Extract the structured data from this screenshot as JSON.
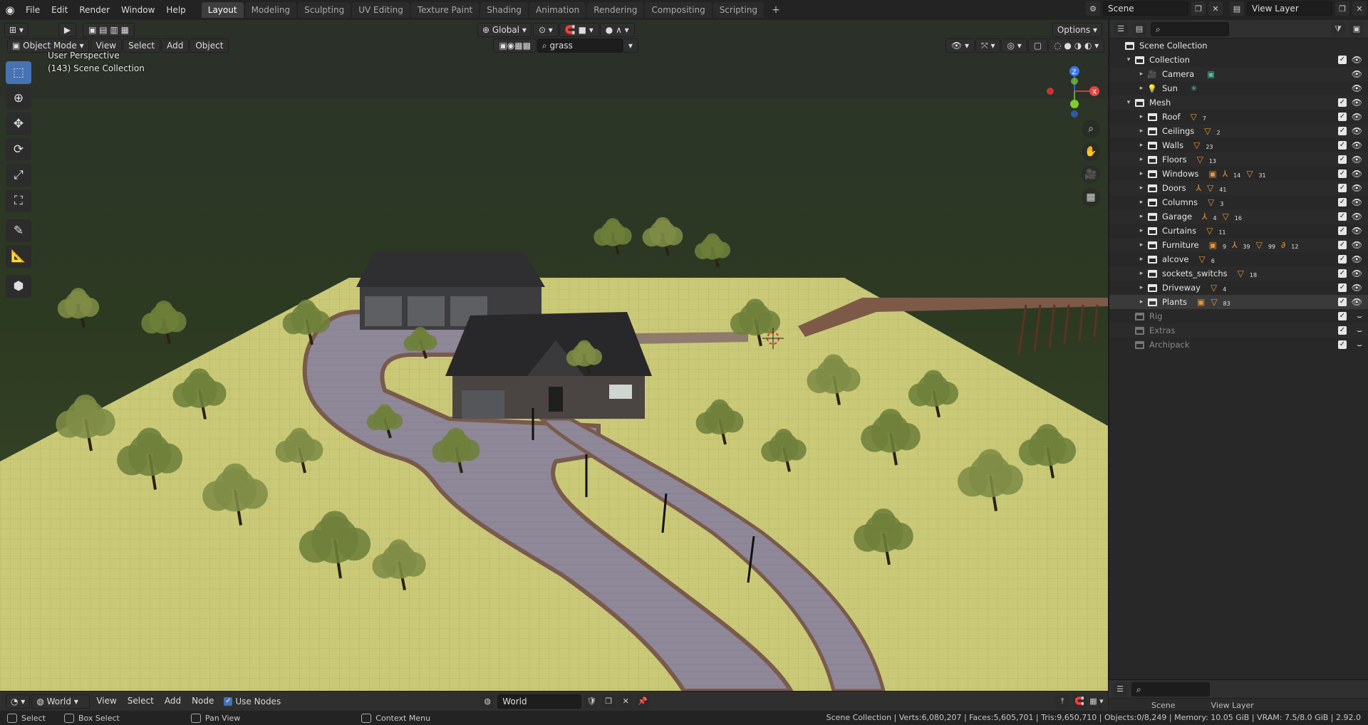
{
  "menu": [
    "File",
    "Edit",
    "Render",
    "Window",
    "Help"
  ],
  "workspace_tabs": [
    {
      "label": "Layout",
      "active": true
    },
    {
      "label": "Modeling"
    },
    {
      "label": "Sculpting"
    },
    {
      "label": "UV Editing"
    },
    {
      "label": "Texture Paint"
    },
    {
      "label": "Shading"
    },
    {
      "label": "Animation"
    },
    {
      "label": "Rendering"
    },
    {
      "label": "Compositing"
    },
    {
      "label": "Scripting"
    }
  ],
  "scene_name": "Scene",
  "view_layer": "View Layer",
  "viewport": {
    "mode": "Object Mode",
    "menus": [
      "View",
      "Select",
      "Add",
      "Object"
    ],
    "orientation": "Global",
    "options": "Options",
    "search_value": "grass",
    "overlay_line1": "User Perspective",
    "overlay_line2": "(143) Scene Collection"
  },
  "outliner": {
    "root": "Scene Collection",
    "rows": [
      {
        "name": "Collection",
        "level": 1,
        "expanded": true,
        "type": "collection"
      },
      {
        "name": "Camera",
        "level": 2,
        "type": "camera",
        "badges": []
      },
      {
        "name": "Sun",
        "level": 2,
        "type": "light",
        "badges": []
      },
      {
        "name": "Mesh",
        "level": 1,
        "expanded": true,
        "type": "collection"
      },
      {
        "name": "Roof",
        "level": 2,
        "type": "collection",
        "badges": [
          {
            "g": "▽",
            "n": "7"
          }
        ]
      },
      {
        "name": "Ceilings",
        "level": 2,
        "type": "collection",
        "badges": [
          {
            "g": "▽",
            "n": "2"
          }
        ]
      },
      {
        "name": "Walls",
        "level": 2,
        "type": "collection",
        "badges": [
          {
            "g": "▽",
            "n": "23"
          }
        ]
      },
      {
        "name": "Floors",
        "level": 2,
        "type": "collection",
        "badges": [
          {
            "g": "▽",
            "n": "13"
          }
        ]
      },
      {
        "name": "Windows",
        "level": 2,
        "type": "collection",
        "badges": [
          {
            "g": "▣",
            "n": ""
          },
          {
            "g": "⅄",
            "n": "14"
          },
          {
            "g": "▽",
            "n": "31"
          }
        ]
      },
      {
        "name": "Doors",
        "level": 2,
        "type": "collection",
        "badges": [
          {
            "g": "⅄",
            "n": ""
          },
          {
            "g": "▽",
            "n": "41"
          }
        ]
      },
      {
        "name": "Columns",
        "level": 2,
        "type": "collection",
        "badges": [
          {
            "g": "▽",
            "n": "3"
          }
        ]
      },
      {
        "name": "Garage",
        "level": 2,
        "type": "collection",
        "badges": [
          {
            "g": "⅄",
            "n": "4"
          },
          {
            "g": "▽",
            "n": "16"
          }
        ]
      },
      {
        "name": "Curtains",
        "level": 2,
        "type": "collection",
        "badges": [
          {
            "g": "▽",
            "n": "11"
          }
        ]
      },
      {
        "name": "Furniture",
        "level": 2,
        "type": "collection",
        "badges": [
          {
            "g": "▣",
            "n": "9"
          },
          {
            "g": "⅄",
            "n": "39"
          },
          {
            "g": "▽",
            "n": "99"
          },
          {
            "g": "∂",
            "n": "12"
          }
        ]
      },
      {
        "name": "alcove",
        "level": 2,
        "type": "collection",
        "badges": [
          {
            "g": "▽",
            "n": "6"
          }
        ]
      },
      {
        "name": "sockets_switchs",
        "level": 2,
        "type": "collection",
        "badges": [
          {
            "g": "▽",
            "n": "18"
          }
        ]
      },
      {
        "name": "Driveway",
        "level": 2,
        "type": "collection",
        "badges": [
          {
            "g": "▽",
            "n": "4"
          }
        ]
      },
      {
        "name": "Plants",
        "level": 2,
        "type": "collection",
        "selected": true,
        "badges": [
          {
            "g": "▣",
            "n": ""
          },
          {
            "g": "▽",
            "n": "83"
          }
        ]
      },
      {
        "name": "Rig",
        "level": 1,
        "dim": true,
        "type": "collection"
      },
      {
        "name": "Extras",
        "level": 1,
        "dim": true,
        "type": "collection"
      },
      {
        "name": "Archipack",
        "level": 1,
        "dim": true,
        "type": "collection"
      }
    ]
  },
  "node_bar": {
    "world": "World",
    "menus": [
      "View",
      "Select",
      "Add",
      "Node"
    ],
    "use_nodes": "Use Nodes",
    "world_field": "World"
  },
  "status": {
    "select": "Select",
    "box_select": "Box Select",
    "pan_view": "Pan View",
    "context_menu": "Context Menu",
    "stats": "Scene Collection | Verts:6,080,207 | Faces:5,605,701 | Tris:9,650,710 | Objects:0/8,249 | Memory: 10.05 GiB | VRAM: 7.5/8.0 GiB | 2.92.0"
  },
  "props_tabs": [
    "Scene",
    "View Layer"
  ]
}
